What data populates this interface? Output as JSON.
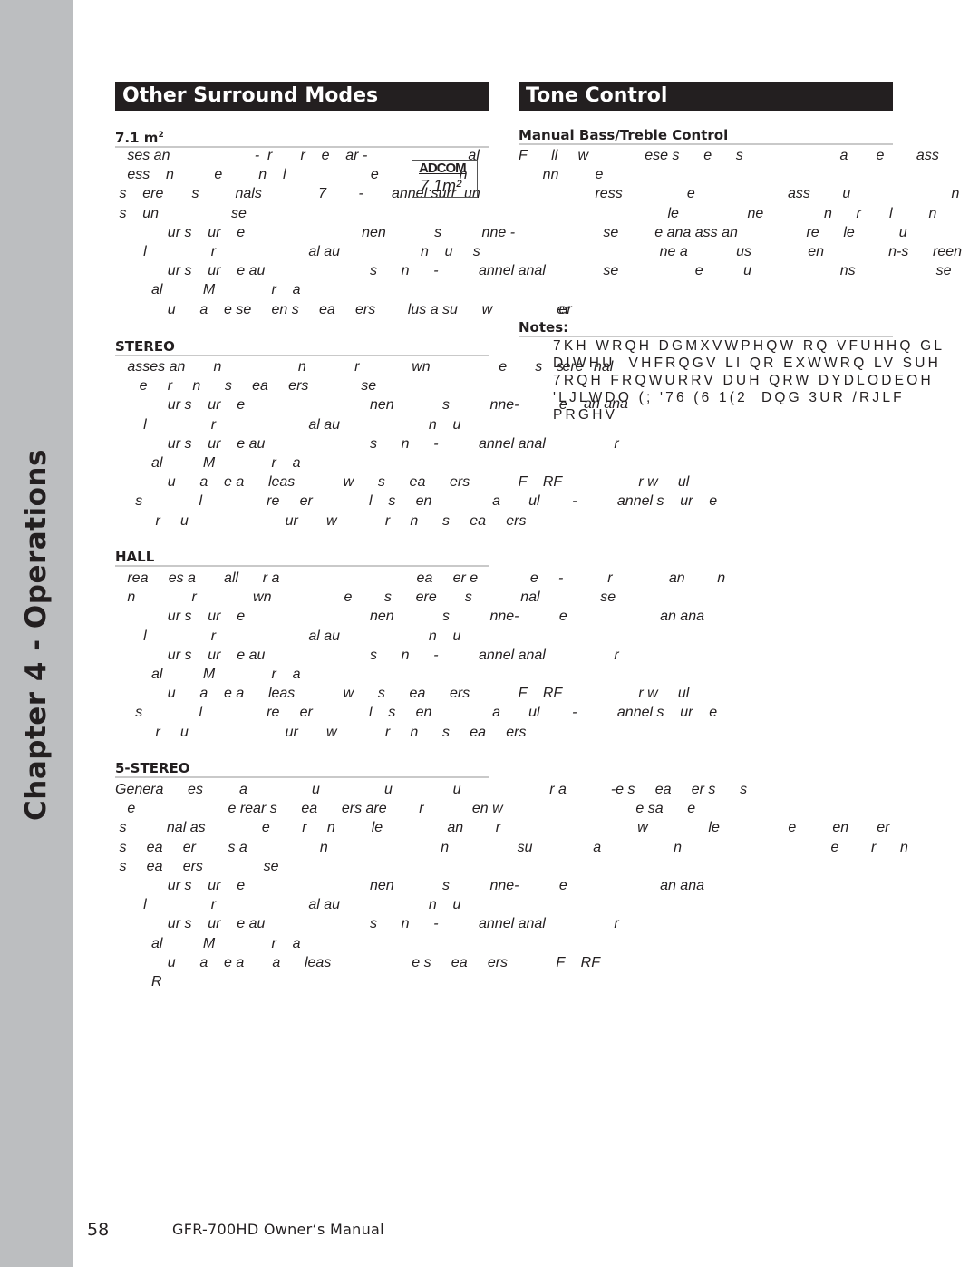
{
  "sidebar": {
    "chapter_label": "Chapter 4 - Operations"
  },
  "left_column": {
    "banner": "Other Surround Modes",
    "sections": [
      {
        "heading": "7.1 m",
        "heading_sup": "2",
        "lines": [
          "   ses an                     -  r       r    e    ar -                         al",
          "   ess    n          e         n    l                     e                    n",
          " s    ere       s         nals              7        -       annel surr  un",
          " s    un                  se",
          "             ur s    ur    e                             nen            s          nne -",
          "       l                r                       al au                    n    u     s",
          "             ur s    ur    e au                          s      n      -          annel anal",
          "         al          M              r    a",
          "             u      a    e se     en s     ea     ers        lus a su      w                er"
        ]
      },
      {
        "heading": "STEREO",
        "lines": [
          "   asses an       n                   n            r             wn                 e       s     ere",
          "      e     r     n      s     ea     ers             se",
          "             ur s    ur    e                               nen            s          nne-          e",
          "       l                r                       al au                      n    u",
          "             ur s    ur    e au                          s      n      -          annel anal                 r",
          "         al          M              r    a",
          "             u      a    e a      leas            w      s      ea      ers            F    RF                   r w     ul",
          "     s              l                re     er              l    s     en               a       ul        -          annel s    ur    e",
          "          r     u                        ur       w            r     n      s     ea     ers"
        ]
      },
      {
        "heading": "HALL",
        "lines": [
          "   rea     es a       all      r a                                  ea     er e             e     -           r              an        n",
          "   n              r              wn                  e        s      ere       s            nal               se",
          "             ur s    ur    e                               nen            s          nne-          e                       an ana",
          "       l                r                       al au                      n    u",
          "             ur s    ur    e au                          s      n      -          annel anal                 r",
          "         al          M              r    a",
          "             u      a    e a      leas            w      s      ea      ers            F    RF                   r w     ul",
          "     s              l                re     er              l    s     en               a       ul        -          annel s    ur    e",
          "          r     u                        ur       w            r     n      s     ea     ers"
        ]
      },
      {
        "heading": "5-STEREO",
        "lines": [
          "Genera      es         a                u                u               u                      r a           -e s     ea     er s      s",
          "   e                       e rear s      ea      ers are        r            en w                                 e sa      e",
          " s          nal as              e        r     n         le                an        r                                  w               le                 e         en       er",
          " s     ea     er        s a                  n                            n                 su               a                  n                                     e        r      n",
          " s     ea     ers               se",
          "             ur s    ur    e                               nen            s          nne-          e                       an ana",
          "       l                r                       al au                      n    u",
          "             ur s    ur    e au                          s      n      -          annel anal                 r",
          "         al          M              r    a",
          "             u      a    e a       a      leas                    e s     ea     ers            F    RF",
          "         R"
        ]
      }
    ],
    "logo": {
      "brand": "ADCOM",
      "model": "7.1m²"
    }
  },
  "right_column": {
    "banner": "Tone Control",
    "section": {
      "heading": "Manual Bass/Treble Control",
      "lines": [
        "F      ll     w              ese s      e      s                        a       e        ass             re      le a                 us",
        "      nn         e",
        "                   ress                e                       ass        u                         n          n                  e re                      e",
        "                                     le                 ne               n      r       l         n",
        "                     se         e ana ass an                 re      le           u                       ns                              r        n",
        "                                   ne a            us              en                n-s      reen                  s      la",
        "                     se                   e          u                      ns                    se                            e          es       re            le       el",
        "",
        "          er"
      ]
    },
    "notes_heading": "Notes:",
    "notes_lines": [
      "7KH WRQH DGMXVWPHQW RQ VFUHHQ GL",
      "DIWHU  VHFRQGV LI QR EXWWRQ LV SUH",
      "7RQH FRQWURRV DUH QRW DYDLODEOH",
      "'LJLWDO (; '76 (6 1(2  DQG 3UR /RJLF",
      "PRGHV"
    ],
    "overlay_fragments": [
      "s",
      "nal",
      "an ana"
    ]
  },
  "footer": {
    "page_number": "58",
    "manual_title": "GFR-700HD Owner‘s Manual"
  }
}
